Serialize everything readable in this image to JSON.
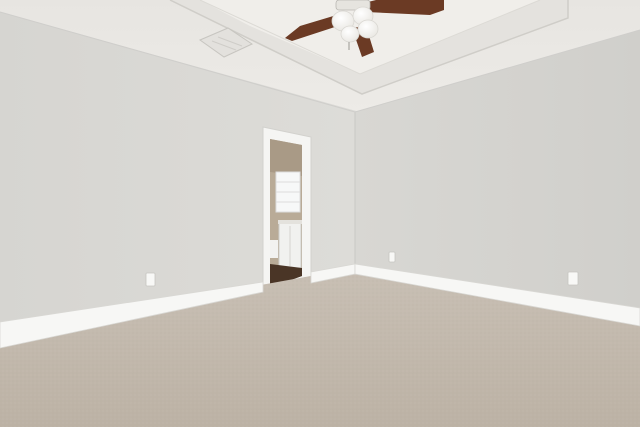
{
  "scene": {
    "type": "empty-room-photo",
    "elements": [
      "tray-ceiling",
      "ceiling-fan-with-light",
      "air-vent",
      "open-doorway-to-bathroom",
      "carpet-floor",
      "white-baseboards",
      "wall-outlets"
    ]
  },
  "colors": {
    "wall_left": "#d9d8d4",
    "wall_right": "#d3d2ce",
    "ceiling": "#eceae6",
    "tray_inner": "#f1efeb",
    "carpet": "#c3b9ad",
    "baseboard": "#f7f7f5",
    "fan_blade": "#6b3a24",
    "bath_floor": "#4a3526"
  }
}
